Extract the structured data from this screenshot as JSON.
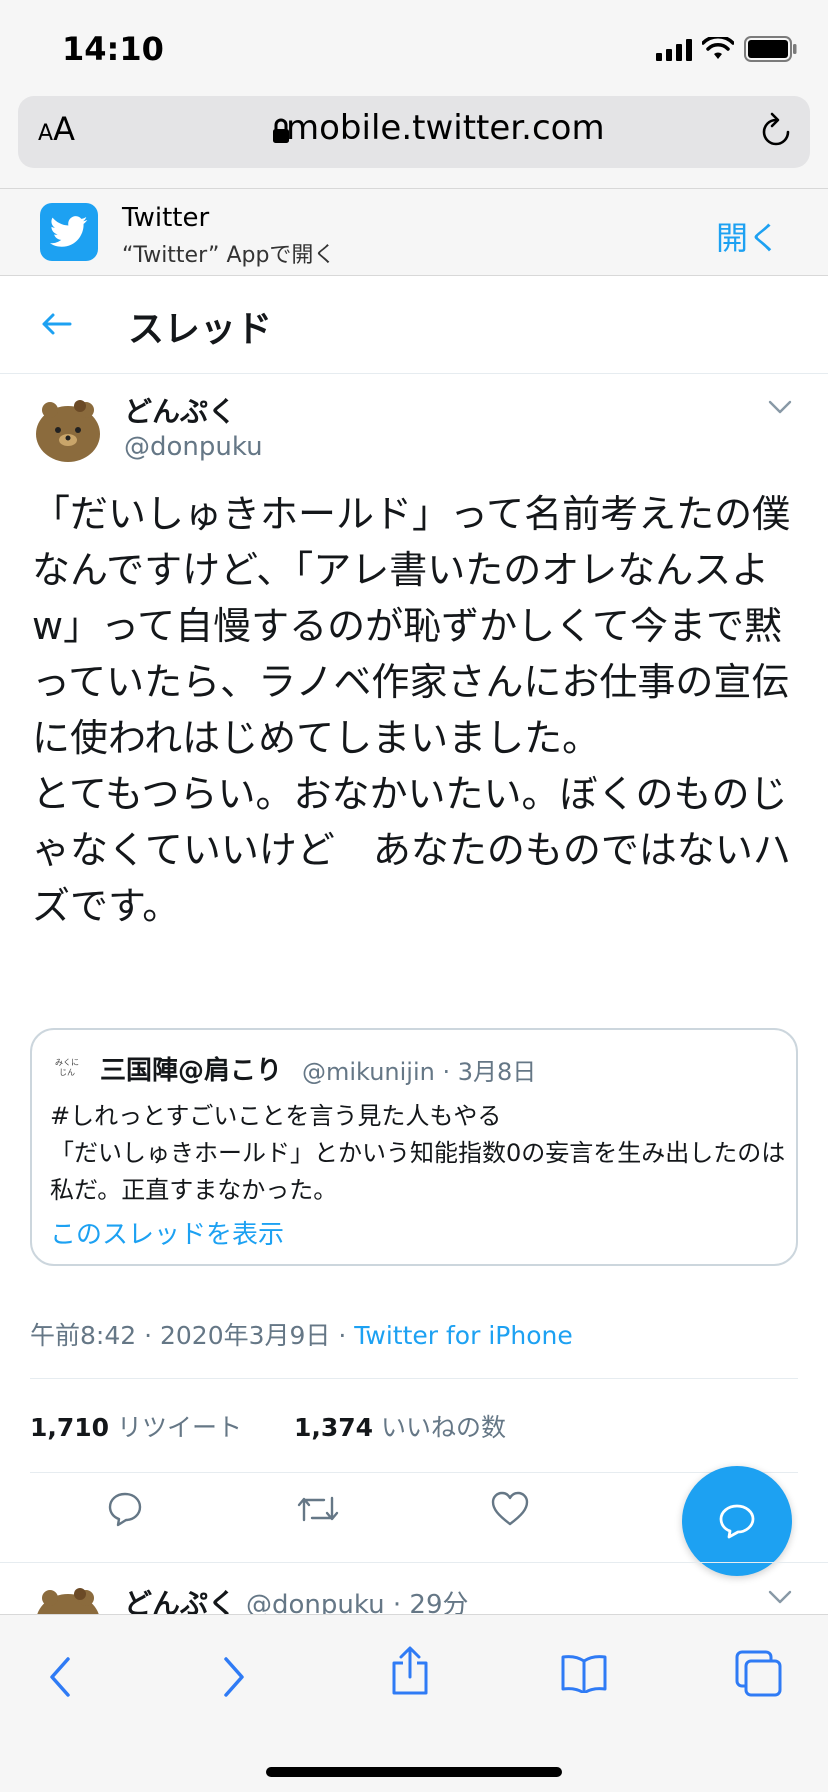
{
  "status": {
    "time": "14:10"
  },
  "browser": {
    "aa": "AA",
    "url": "mobile.twitter.com"
  },
  "app_banner": {
    "name": "Twitter",
    "subtitle": "“Twitter” Appで開く",
    "open_label": "開く"
  },
  "header": {
    "title": "スレッド"
  },
  "tweet": {
    "display_name": "どんぷく",
    "handle": "@donpuku",
    "text": "「だいしゅきホールド」って名前考えたの僕なんですけど、「アレ書いたのオレなんスよw」って自慢するのが恥ずかしくて今まで黙っていたら、ラノベ作家さんにお仕事の宣伝に使われはじめてしまいました。\nとてもつらい。おなかいたい。ぼくのものじゃなくていいけど　あなたのものではないハズです。",
    "timestamp": "午前8:42 · 2020年3月9日 · ",
    "source": "Twitter for iPhone",
    "retweets_count": "1,710",
    "retweets_label": "リツイート",
    "likes_count": "1,374",
    "likes_label": "いいねの数"
  },
  "quote": {
    "avatar_text": "みくに じん",
    "display_name": "三国陣@肩こり",
    "meta": "@mikunijin · 3月8日",
    "text": "#しれっとすごいことを言う見た人もやる\n「だいしゅきホールド」とかいう知能指数0の妄言を生み出したのは私だ。正直すまなかった。",
    "link": "このスレッドを表示"
  },
  "next_tweet": {
    "display_name": "どんぷく",
    "meta": "@donpuku · 29分"
  },
  "colors": {
    "accent": "#1da1f2",
    "muted": "#657786",
    "text": "#14171a"
  }
}
